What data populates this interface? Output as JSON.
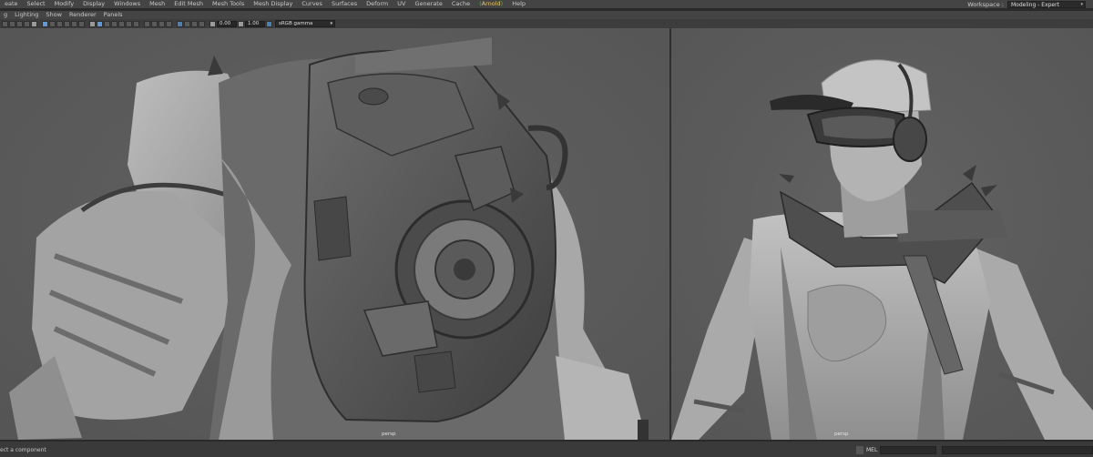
{
  "menubar": {
    "items": [
      "eate",
      "Select",
      "Modify",
      "Display",
      "Windows",
      "Mesh",
      "Edit Mesh",
      "Mesh Tools",
      "Mesh Display",
      "Curves",
      "Surfaces",
      "Deform",
      "UV",
      "Generate",
      "Cache"
    ],
    "arnold_label": "Arnold",
    "help_label": "Help",
    "workspace_label": "Workspace :",
    "workspace_value": "Modeling - Expert",
    "workspace_chevron": "▾"
  },
  "panel_menu": {
    "items": [
      "g",
      "Lighting",
      "Show",
      "Renderer",
      "Panels"
    ]
  },
  "panel_toolbar": {
    "exposure_value": "0.00",
    "gamma_value": "1.00",
    "colorspace_value": "sRGB gamma",
    "colorspace_chevron": "▾"
  },
  "viewports": {
    "left_label": "persp",
    "right_label": "persp"
  },
  "status": {
    "help_text": "ect a component",
    "mel_label": "MEL"
  },
  "colors": {
    "viewport_bg": "#5a5a5a",
    "ui_dark": "#444444",
    "arnold_accent": "#e8c86a"
  }
}
